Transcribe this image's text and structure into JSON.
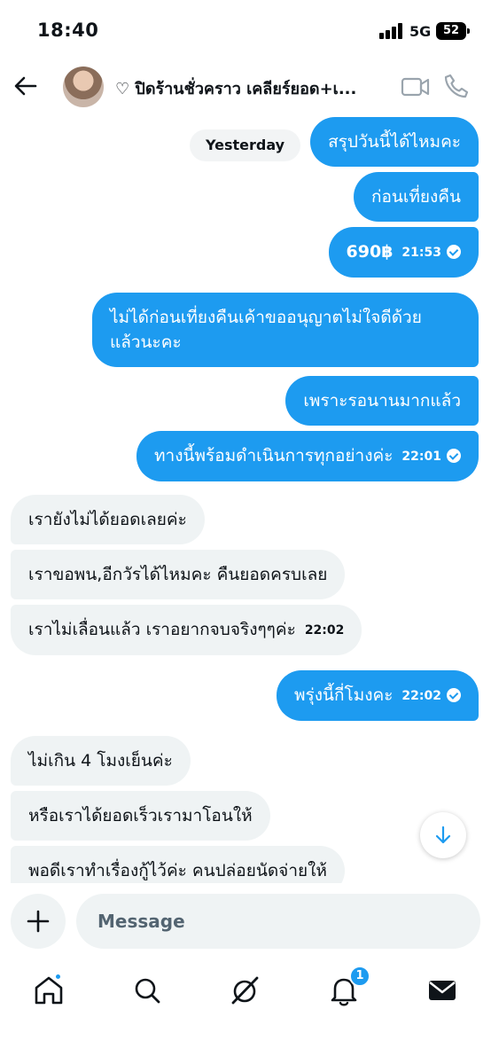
{
  "status_bar": {
    "time": "18:40",
    "network": "5G",
    "battery": "52"
  },
  "header": {
    "title": "♡ ปิดร้านชั่วคราว เคลียร์ยอด+เ...",
    "icons": [
      "back-arrow-icon",
      "video-camera-icon",
      "phone-icon"
    ]
  },
  "date_label": "Yesterday",
  "messages": [
    {
      "dir": "out",
      "text": "สรุปวันนี้ได้ไหมคะ",
      "time": ""
    },
    {
      "dir": "out",
      "text": "ก่อนเที่ยงคืน",
      "time": ""
    },
    {
      "dir": "out",
      "text": "690฿",
      "time": "21:53"
    },
    {
      "dir": "out",
      "text": "ไม่ได้ก่อนเที่ยงคืนเค้าขออนุญาตไม่ใจดีด้วย",
      "text2": "แล้วนะคะ",
      "time": ""
    },
    {
      "dir": "out",
      "text": "เพราะรอนานมากแล้ว",
      "time": ""
    },
    {
      "dir": "out",
      "text": "ทางนี้พร้อมดำเนินการทุกอย่างค่ะ",
      "time": "22:01"
    },
    {
      "dir": "in",
      "text": "เรายังไม่ได้ยอดเลยค่ะ",
      "time": ""
    },
    {
      "dir": "in",
      "text": "เราขอพน,อีกวัรได้ไหมคะ คืนยอดครบเลย",
      "time": ""
    },
    {
      "dir": "in",
      "text": "เราไม่เลื่อนแล้ว เราอยากจบจริงๆๆค่ะ",
      "time": "22:02"
    },
    {
      "dir": "out",
      "text": "พรุ่งนี้กี่โมงคะ",
      "time": "22:02"
    },
    {
      "dir": "in",
      "text": "ไม่เกิน 4 โมงเย็นค่ะ",
      "time": ""
    },
    {
      "dir": "in",
      "text": "หรือเราได้ยอดเร็วเรามาโอนให้",
      "time": ""
    },
    {
      "dir": "in",
      "text": "พอดีเราทำเรื่องกู้ไว้ค่ะ คนปล่อยนัดจ่ายให้",
      "time": ""
    }
  ],
  "composer": {
    "placeholder": "Message",
    "value": ""
  },
  "nav": {
    "notification_count": "1",
    "icons": [
      "home-icon",
      "search-icon",
      "grok-icon",
      "bell-icon",
      "mail-icon"
    ]
  },
  "colors": {
    "accent": "#1d9bf0",
    "incoming_bg": "#eff3f4"
  }
}
